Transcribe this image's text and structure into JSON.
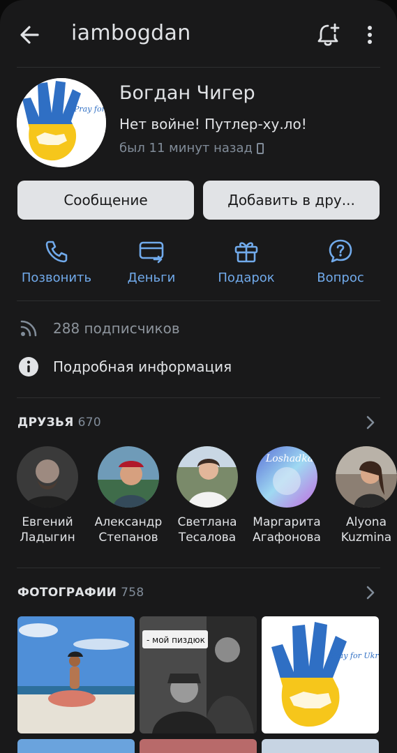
{
  "header": {
    "back_icon": "arrow-left-icon",
    "username": "iambogdan",
    "bell_icon": "bell-plus-icon",
    "more_icon": "more-vertical-icon"
  },
  "profile": {
    "name": "Богдан Чигер",
    "status": "Нет войне! Путлер-ху.ло!",
    "last_seen": "был 11 минут назад",
    "device_icon": "phone-icon",
    "avatar_text": "Pray for Ukraine!"
  },
  "buttons": {
    "message": "Сообщение",
    "add_friend": "Добавить в дру..."
  },
  "actions": [
    {
      "label": "Позвонить",
      "icon": "phone-icon"
    },
    {
      "label": "Деньги",
      "icon": "money-transfer-icon"
    },
    {
      "label": "Подарок",
      "icon": "gift-icon"
    },
    {
      "label": "Вопрос",
      "icon": "question-icon"
    }
  ],
  "info": {
    "subscribers": "288 подписчиков",
    "details": "Подробная информация"
  },
  "friends": {
    "title": "ДРУЗЬЯ",
    "count": "670",
    "items": [
      {
        "first": "Евгений",
        "last": "Ладыгин"
      },
      {
        "first": "Александр",
        "last": "Степанов"
      },
      {
        "first": "Светлана",
        "last": "Тесалова"
      },
      {
        "first": "Маргарита",
        "last": "Агафонова",
        "overlay": "Loshadka"
      },
      {
        "first": "Alyona",
        "last": "Kuzmina"
      }
    ]
  },
  "photos": {
    "title": "ФОТОГРАФИИ",
    "count": "758",
    "caption": "- мой пиздюк",
    "hand_text": "Pray for Ukraine!"
  },
  "colors": {
    "background": "#19191a",
    "accent": "#71aaeb",
    "text": "#e1e3e6",
    "secondary": "#818c99",
    "button": "#e1e3e6",
    "ukraine_blue": "#2f6fc4",
    "ukraine_yellow": "#f6c61b"
  }
}
